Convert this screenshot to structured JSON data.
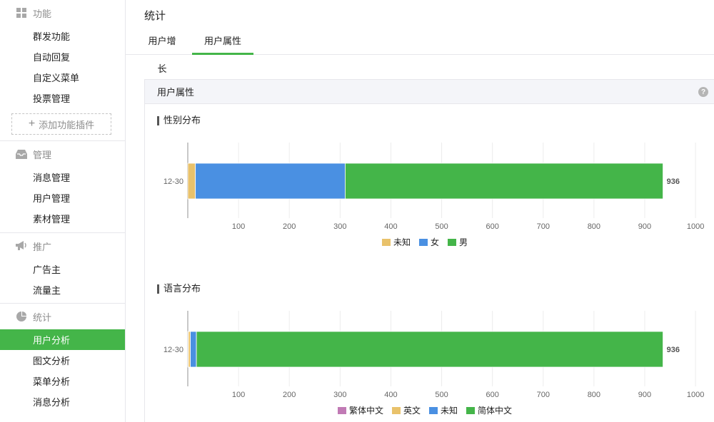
{
  "sidebar": {
    "sections": [
      {
        "title": "功能",
        "icon": "grid-icon",
        "items": [
          {
            "label": "群发功能",
            "active": false
          },
          {
            "label": "自动回复",
            "active": false
          },
          {
            "label": "自定义菜单",
            "active": false
          },
          {
            "label": "投票管理",
            "active": false
          }
        ],
        "add_plugin": "添加功能插件"
      },
      {
        "title": "管理",
        "icon": "inbox-icon",
        "items": [
          {
            "label": "消息管理",
            "active": false
          },
          {
            "label": "用户管理",
            "active": false
          },
          {
            "label": "素材管理",
            "active": false
          }
        ]
      },
      {
        "title": "推广",
        "icon": "megaphone-icon",
        "items": [
          {
            "label": "广告主",
            "active": false
          },
          {
            "label": "流量主",
            "active": false
          }
        ]
      },
      {
        "title": "统计",
        "icon": "pie-chart-icon",
        "items": [
          {
            "label": "用户分析",
            "active": true
          },
          {
            "label": "图文分析",
            "active": false
          },
          {
            "label": "菜单分析",
            "active": false
          },
          {
            "label": "消息分析",
            "active": false
          }
        ]
      }
    ]
  },
  "header": {
    "title": "统计"
  },
  "tabs": [
    {
      "label": "用户增长",
      "active": false
    },
    {
      "label": "用户属性",
      "active": true
    }
  ],
  "panel": {
    "title": "用户属性",
    "help": "?"
  },
  "colors": {
    "accent": "#44b549",
    "unknown": "#e9c26b",
    "female": "#4a90e2",
    "male": "#44b549",
    "traditional": "#c17ab5"
  },
  "chart_data": [
    {
      "type": "bar",
      "orientation": "horizontal",
      "stacked": true,
      "title": "性别分布",
      "categories": [
        "12-30"
      ],
      "series": [
        {
          "name": "未知",
          "values": [
            15
          ],
          "color": "#e9c26b"
        },
        {
          "name": "女",
          "values": [
            295
          ],
          "color": "#4a90e2"
        },
        {
          "name": "男",
          "values": [
            626
          ],
          "color": "#44b549"
        }
      ],
      "total_label": "936",
      "xlim": [
        0,
        1000
      ],
      "xticks": [
        100,
        200,
        300,
        400,
        500,
        600,
        700,
        800,
        900,
        1000
      ],
      "legend": "bottom",
      "grid": true
    },
    {
      "type": "bar",
      "orientation": "horizontal",
      "stacked": true,
      "title": "语言分布",
      "categories": [
        "12-30"
      ],
      "series": [
        {
          "name": "繁体中文",
          "values": [
            1
          ],
          "color": "#c17ab5"
        },
        {
          "name": "英文",
          "values": [
            4
          ],
          "color": "#e9c26b"
        },
        {
          "name": "未知",
          "values": [
            12
          ],
          "color": "#4a90e2"
        },
        {
          "name": "简体中文",
          "values": [
            919
          ],
          "color": "#44b549"
        }
      ],
      "total_label": "936",
      "xlim": [
        0,
        1000
      ],
      "xticks": [
        100,
        200,
        300,
        400,
        500,
        600,
        700,
        800,
        900,
        1000
      ],
      "legend": "bottom",
      "grid": true
    }
  ]
}
